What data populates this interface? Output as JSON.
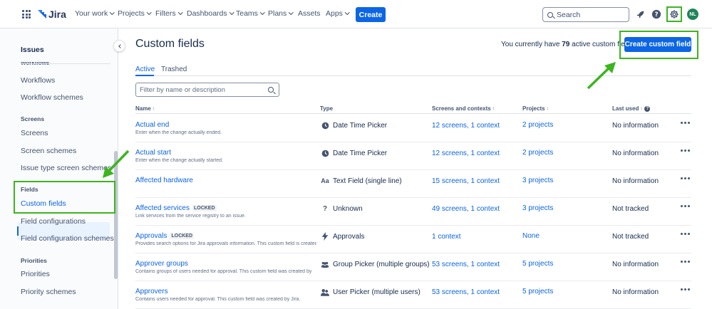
{
  "topnav": {
    "logo": "Jira",
    "items": [
      {
        "label": "Your work",
        "chevron": true
      },
      {
        "label": "Projects",
        "chevron": true
      },
      {
        "label": "Filters",
        "chevron": true
      },
      {
        "label": "Dashboards",
        "chevron": true
      },
      {
        "label": "Teams",
        "chevron": true
      },
      {
        "label": "Plans",
        "chevron": true
      },
      {
        "label": "Assets",
        "chevron": false
      },
      {
        "label": "Apps",
        "chevron": true
      }
    ],
    "create_label": "Create",
    "search_placeholder": "Search",
    "avatar_initials": "NL"
  },
  "sidebar": {
    "title": "Issues",
    "cut_heading": "Workflows",
    "items": [
      {
        "type": "item",
        "label": "Workflows"
      },
      {
        "type": "item",
        "label": "Workflow schemes"
      },
      {
        "type": "head",
        "label": "Screens"
      },
      {
        "type": "item",
        "label": "Screens"
      },
      {
        "type": "item",
        "label": "Screen schemes"
      },
      {
        "type": "item",
        "label": "Issue type screen schemes"
      },
      {
        "type": "head",
        "label": "Fields"
      },
      {
        "type": "item",
        "label": "Custom fields",
        "active": true
      },
      {
        "type": "item",
        "label": "Field configurations"
      },
      {
        "type": "item",
        "label": "Field configuration schemes"
      },
      {
        "type": "head",
        "label": "Priorities"
      },
      {
        "type": "item",
        "label": "Priorities"
      },
      {
        "type": "item",
        "label": "Priority schemes"
      }
    ]
  },
  "main": {
    "title": "Custom fields",
    "count_prefix": "You currently have ",
    "count": "79",
    "count_suffix": " active custom fields",
    "create_field_label": "Create custom field",
    "tabs": [
      {
        "label": "Active"
      },
      {
        "label": "Trashed"
      }
    ],
    "filter_placeholder": "Filter by name or description",
    "columns": {
      "name": "Name",
      "type": "Type",
      "screens": "Screens and contexts",
      "projects": "Projects",
      "last_used": "Last used"
    },
    "rows": [
      {
        "name": "Actual end",
        "locked": false,
        "desc": "Enter when the change actually ended.",
        "type_icon": "clock-icon",
        "type": "Date Time Picker",
        "screens": "12 screens, 1 context",
        "projects": "2 projects",
        "last_used": "No information"
      },
      {
        "name": "Actual start",
        "locked": false,
        "desc": "Enter when the change actually started.",
        "type_icon": "clock-icon",
        "type": "Date Time Picker",
        "screens": "12 screens, 1 context",
        "projects": "2 projects",
        "last_used": "No information"
      },
      {
        "name": "Affected hardware",
        "locked": false,
        "desc": "",
        "type_icon": "text-field-icon",
        "type": "Text Field (single line)",
        "screens": "15 screens, 1 context",
        "projects": "3 projects",
        "last_used": "No information"
      },
      {
        "name": "Affected services",
        "locked": true,
        "desc": "Link services from the service registry to an issue.",
        "type_icon": "question-icon",
        "type": "Unknown",
        "screens": "49 screens, 1 context",
        "projects": "3 projects",
        "last_used": "Not tracked"
      },
      {
        "name": "Approvals",
        "locked": true,
        "desc": "Provides search options for Jira approvals information. This custom field is created",
        "type_icon": "lightning-icon",
        "type": "Approvals",
        "screens": "1 context",
        "projects": "None",
        "last_used": "Not tracked"
      },
      {
        "name": "Approver groups",
        "locked": false,
        "desc": "Contains groups of users needed for approval. This custom field was created by",
        "type_icon": "group-icon",
        "type": "Group Picker (multiple groups)",
        "screens": "53 screens, 1 context",
        "projects": "5 projects",
        "last_used": "No information"
      },
      {
        "name": "Approvers",
        "locked": false,
        "desc": "Contains users needed for approval. This custom field was created by Jira.",
        "type_icon": "users-icon",
        "type": "User Picker (multiple users)",
        "screens": "53 screens, 1 context",
        "projects": "5 projects",
        "last_used": "No information"
      }
    ],
    "lock_label": "LOCKED"
  },
  "colors": {
    "brand_blue": "#0c66e4",
    "highlight_green": "#3cb51f",
    "avatar_green": "#1f845a"
  }
}
